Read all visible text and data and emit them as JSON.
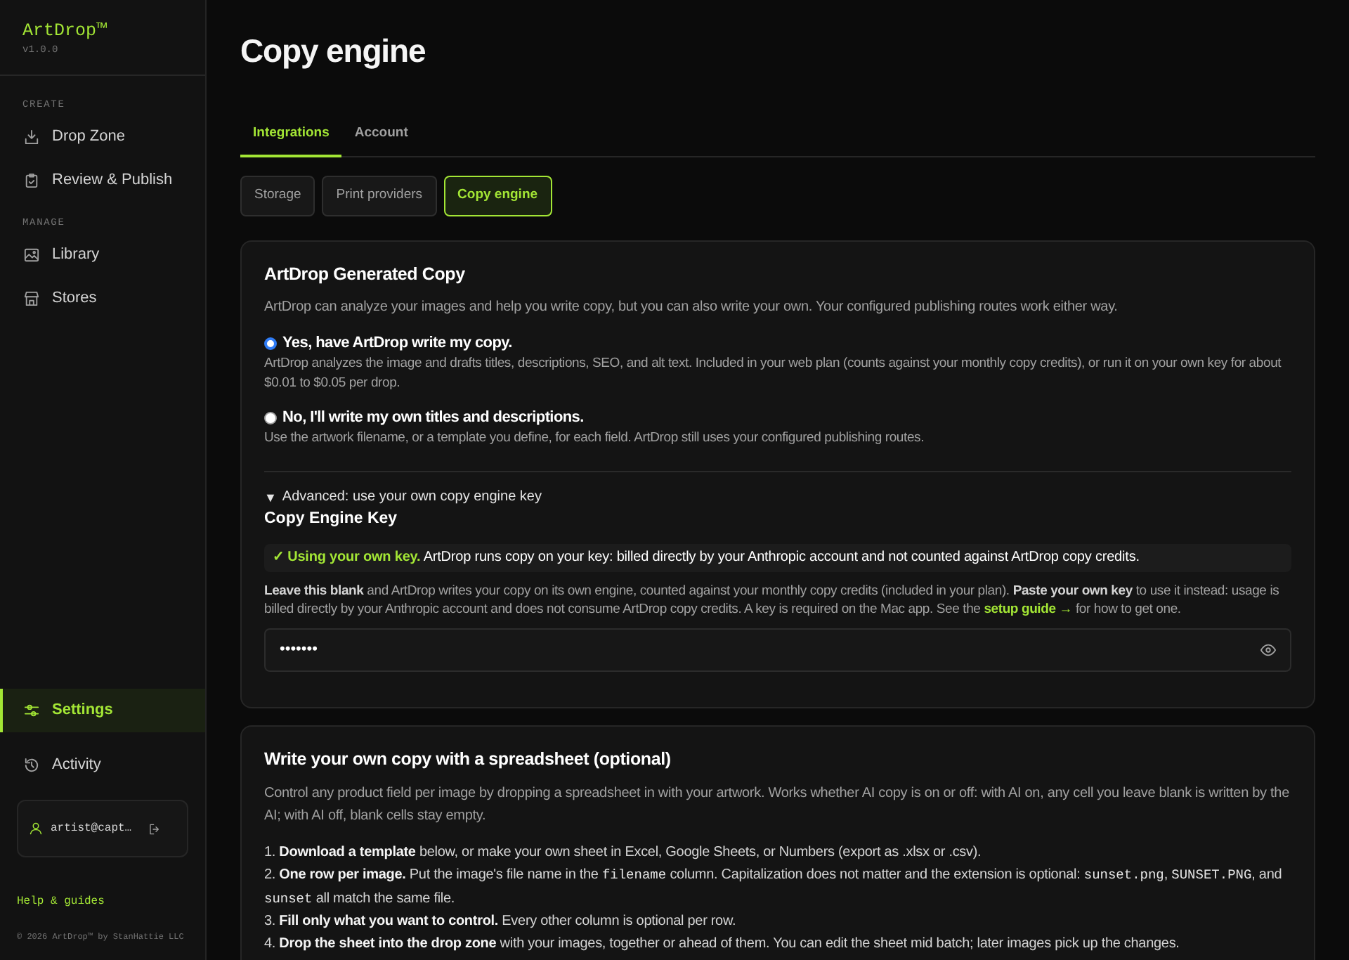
{
  "sidebar": {
    "logo": "ArtDrop™",
    "version": "v1.0.0",
    "sections": [
      {
        "label": "CREATE",
        "items": [
          {
            "label": "Drop Zone",
            "selected": false
          },
          {
            "label": "Review & Publish",
            "selected": false
          }
        ]
      },
      {
        "label": "MANAGE",
        "items": [
          {
            "label": "Library",
            "selected": false
          },
          {
            "label": "Stores",
            "selected": false
          }
        ]
      }
    ],
    "bottom_items": [
      {
        "label": "Settings",
        "selected": true
      },
      {
        "label": "Activity",
        "selected": false
      }
    ],
    "account": {
      "email": "artist@capt…"
    },
    "help_link": "Help & guides",
    "copyright": "© 2026 ArtDrop™ by StanHattie LLC"
  },
  "page": {
    "title": "Copy engine"
  },
  "tabs": [
    {
      "label": "Integrations",
      "selected": true
    },
    {
      "label": "Account",
      "selected": false
    }
  ],
  "subtabs": [
    {
      "label": "Storage",
      "selected": false
    },
    {
      "label": "Print providers",
      "selected": false
    },
    {
      "label": "Copy engine",
      "selected": true
    }
  ],
  "copy_card": {
    "title": "ArtDrop Generated Copy",
    "description": "ArtDrop can analyze your images and help you write copy, but you can also write your own. Your configured publishing routes work either way.",
    "options": [
      {
        "label": "Yes, have ArtDrop write my copy.",
        "description": "ArtDrop analyzes the image and drafts titles, descriptions, SEO, and alt text. Included in your web plan (counts against your monthly copy credits), or run it on your own key for about $0.01 to $0.05 per drop.",
        "selected": true
      },
      {
        "label": "No, I'll write my own titles and descriptions.",
        "description": "Use the artwork filename, or a template you define, for each field. ArtDrop still uses your configured publishing routes.",
        "selected": false
      }
    ],
    "advanced": {
      "marker": "▼",
      "summary": "Advanced: use your own copy engine key",
      "expanded": true,
      "heading": "Copy Engine Key",
      "notice": {
        "lead": "✓ Using your own key.",
        "text": "ArtDrop runs copy on your key: billed directly by your Anthropic account and not counted against ArtDrop copy credits."
      },
      "help": [
        {
          "kind": "text",
          "text": "**Leave this blank** and ArtDrop writes your copy on its own engine, counted against your monthly copy credits (included in your plan). **Paste your own key** to use it instead: usage is billed directly by your Anthropic account and does not consume ArtDrop copy credits. A key is required on the Mac app. See the "
        },
        {
          "kind": "link",
          "text": "setup guide →"
        },
        {
          "kind": "text",
          "text": " for how to get one."
        }
      ],
      "key_field": {
        "value": "•••••••"
      }
    }
  },
  "spreadsheet_card": {
    "title": "Write your own copy with a spreadsheet (optional)",
    "description": "Control any product field per image by dropping a spreadsheet in with your artwork. Works whether AI copy is on or off: with AI on, any cell you leave blank is written by the AI; with AI off, blank cells stay empty.",
    "steps": [
      {
        "number": "1.",
        "parts": [
          {
            "kind": "text",
            "text": "**Download a template** below, or make your own sheet in Excel, Google Sheets, or Numbers (export as .xlsx or .csv)."
          }
        ]
      },
      {
        "number": "2.",
        "parts": [
          {
            "kind": "text",
            "text": "**One row per image.** Put the image's file name in the "
          },
          {
            "kind": "code",
            "text": "filename"
          },
          {
            "kind": "text",
            "text": " column. Capitalization does not matter and the extension is optional: "
          },
          {
            "kind": "code",
            "text": "sunset.png"
          },
          {
            "kind": "text",
            "text": ", "
          },
          {
            "kind": "code",
            "text": "SUNSET.PNG"
          },
          {
            "kind": "text",
            "text": ", and "
          },
          {
            "kind": "code",
            "text": "sunset"
          },
          {
            "kind": "text",
            "text": " all match the same file."
          }
        ]
      },
      {
        "number": "3.",
        "parts": [
          {
            "kind": "text",
            "text": "**Fill only what you want to control.** Every other column is optional per row."
          }
        ]
      },
      {
        "number": "4.",
        "parts": [
          {
            "kind": "text",
            "text": "**Drop the sheet into the drop zone** with your images, together or ahead of them. You can edit the sheet mid batch; later images pick up the changes."
          }
        ]
      }
    ]
  }
}
